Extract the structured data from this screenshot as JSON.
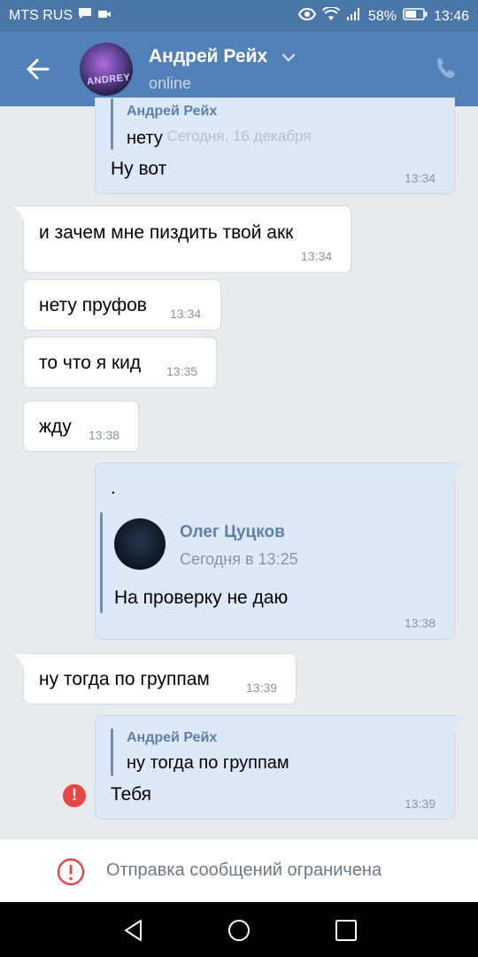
{
  "status_bar": {
    "carrier": "MTS RUS",
    "battery": "58%",
    "time": "13:46"
  },
  "header": {
    "contact_name": "Андрей Рейх",
    "status": "online",
    "avatar_text": "ANDREY"
  },
  "ghost_date": "Сегодня, 16 декабря",
  "messages": [
    {
      "reply_author": "Андрей Рейх",
      "reply_text": "нету",
      "text": "Ну вот",
      "time": "13:34"
    },
    {
      "text": "и зачем мне пиздить твой акк",
      "time": "13:34"
    },
    {
      "text": "нету пруфов",
      "time": "13:34"
    },
    {
      "text": "то что я кид",
      "time": "13:35"
    },
    {
      "text": "жду",
      "time": "13:38"
    },
    {
      "text": ".",
      "fwd_name": "Олег Цуцков",
      "fwd_date": "Сегодня в 13:25",
      "fwd_text": "На проверку не даю",
      "time": "13:38"
    },
    {
      "text": "ну тогда по группам",
      "time": "13:39"
    },
    {
      "reply_author": "Андрей Рейх",
      "reply_text": "ну тогда по группам",
      "text": "Тебя",
      "time": "13:39"
    }
  ],
  "restriction": {
    "text": "Отправка сообщений ограничена"
  },
  "colors": {
    "header": "#5181b8",
    "status_bar": "#4a76a8",
    "chat_bg": "#e8ebee",
    "outgoing_bubble": "#dde9f8",
    "incoming_bubble": "#ffffff",
    "error": "#e64646"
  },
  "icons": [
    "back-arrow-icon",
    "chevron-down-icon",
    "phone-icon",
    "error-icon",
    "nav-back-icon",
    "nav-home-icon",
    "nav-recents-icon"
  ]
}
